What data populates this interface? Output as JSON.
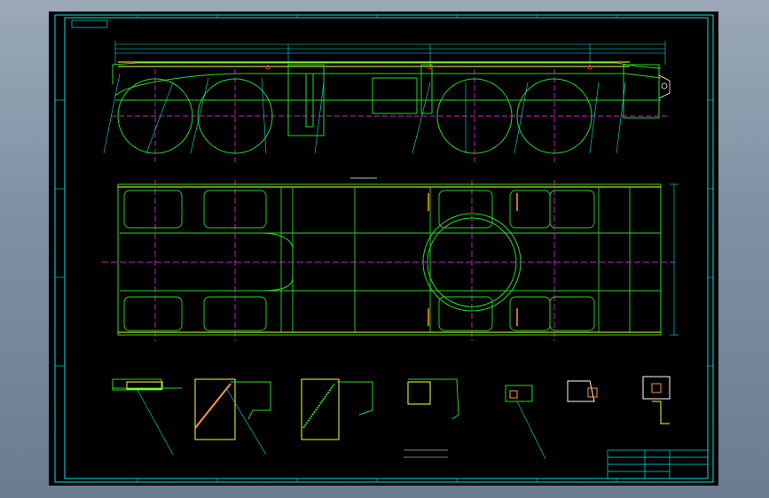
{
  "viewport": {
    "background": "#000000",
    "frame_color": "#00e5e5"
  },
  "drawing": {
    "corner_tag": "",
    "section_label": "",
    "notes": [],
    "title_block": {
      "drawing_name": "",
      "rows": []
    }
  },
  "colors": {
    "cyan": "#00e5e5",
    "yellow": "#ffff33",
    "green": "#22dd22",
    "lime": "#aaff33",
    "magenta": "#ff33ff",
    "white": "#ffffff",
    "red": "#ff3333",
    "orange": "#ff9933"
  }
}
